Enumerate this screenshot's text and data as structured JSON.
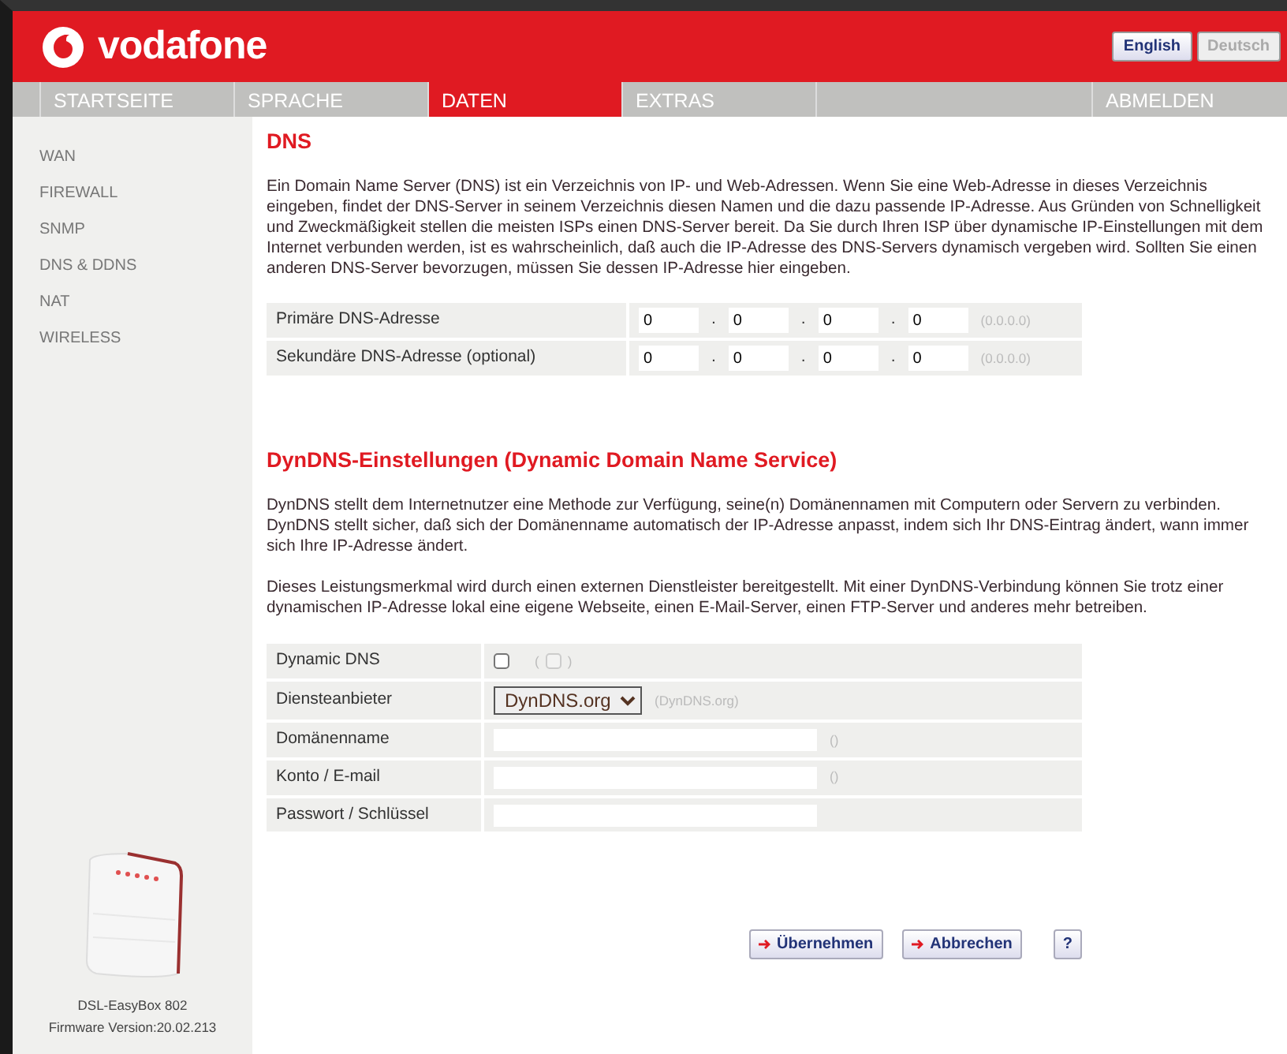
{
  "header": {
    "brand": "vodafone",
    "languages": [
      {
        "label": "English",
        "selected": true
      },
      {
        "label": "Deutsch",
        "selected": false
      }
    ]
  },
  "nav": [
    {
      "label": "STARTSEITE",
      "selected": false
    },
    {
      "label": "SPRACHE",
      "selected": false
    },
    {
      "label": "DATEN",
      "selected": true
    },
    {
      "label": "EXTRAS",
      "selected": false
    },
    {
      "label": "ABMELDEN",
      "selected": false
    }
  ],
  "sidebar": {
    "items": [
      "WAN",
      "FIREWALL",
      "SNMP",
      "DNS & DDNS",
      "NAT",
      "WIRELESS"
    ],
    "device": {
      "model": "DSL-EasyBox 802",
      "firmware": "Firmware Version:20.02.213"
    }
  },
  "dns": {
    "title": "DNS",
    "description": "Ein Domain Name Server (DNS) ist ein Verzeichnis von IP- und Web-Adressen. Wenn Sie eine Web-Adresse in dieses Verzeichnis eingeben, findet der DNS-Server in seinem Verzeichnis diesen Namen und die dazu passende IP-Adresse. Aus Gründen von Schnelligkeit und Zweckmäßigkeit stellen die meisten ISPs einen DNS-Server bereit. Da Sie durch Ihren ISP über dynamische IP-Einstellungen mit dem Internet verbunden werden, ist es wahrscheinlich, daß auch die IP-Adresse des DNS-Servers dynamisch vergeben wird. Sollten Sie einen anderen DNS-Server bevorzugen, müssen Sie dessen IP-Adresse hier eingeben.",
    "rows": [
      {
        "label": "Primäre DNS-Adresse",
        "octets": [
          "0",
          "0",
          "0",
          "0"
        ],
        "separators": [
          ".",
          ".",
          "."
        ],
        "hint": "(0.0.0.0)"
      },
      {
        "label": "Sekundäre DNS-Adresse (optional)",
        "octets": [
          "0",
          "0",
          "0",
          "0"
        ],
        "separators": [
          ".",
          ".",
          "."
        ],
        "hint": "(0.0.0.0)"
      }
    ]
  },
  "dyndns": {
    "title": "DynDNS-Einstellungen (Dynamic Domain Name Service)",
    "paragraphs": [
      "DynDNS stellt dem Internetnutzer eine Methode zur Verfügung, seine(n) Domänennamen mit Computern oder Servern zu verbinden. DynDNS stellt sicher, daß sich der Domänenname automatisch der IP-Adresse anpasst, indem sich Ihr DNS-Eintrag ändert, wann immer sich Ihre IP-Adresse ändert.",
      "Dieses Leistungsmerkmal wird durch einen externen Dienstleister bereitgestellt. Mit einer DynDNS-Verbindung können Sie trotz einer dynamischen IP-Adresse lokal eine eigene Webseite, einen E-Mail-Server, einen FTP-Server und anderes mehr betreiben."
    ],
    "rows": [
      {
        "kind": "checkbox",
        "label": "Dynamic DNS",
        "checked": false,
        "hint_open": "(",
        "hint_checked": false,
        "hint_close": ")"
      },
      {
        "kind": "select",
        "label": "Diensteanbieter",
        "value": "DynDNS.org",
        "hint": "(DynDNS.org)"
      },
      {
        "kind": "text",
        "label": "Domänenname",
        "hint": "()"
      },
      {
        "kind": "text",
        "label": "Konto / E-mail",
        "hint": "()"
      },
      {
        "kind": "text",
        "label": "Passwort / Schlüssel"
      }
    ]
  },
  "buttons": [
    {
      "kind": "action",
      "label": "Übernehmen"
    },
    {
      "kind": "action",
      "label": "Abbrechen"
    },
    {
      "kind": "help",
      "label": "?"
    }
  ]
}
